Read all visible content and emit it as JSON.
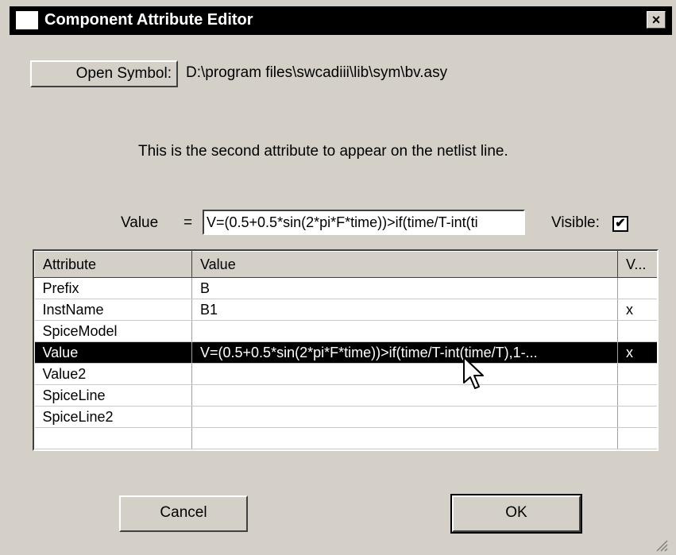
{
  "window": {
    "title": "Component Attribute Editor",
    "close_glyph": "×"
  },
  "symbol": {
    "open_button_label": "Open Symbol:",
    "path": "D:\\program files\\swcadiii\\lib\\sym\\bv.asy"
  },
  "description": "This is the second attribute to appear on the netlist line.",
  "value_field": {
    "label": "Value",
    "equals": "=",
    "text": "V=(0.5+0.5*sin(2*pi*F*time))>if(time/T-int(ti",
    "visible_label": "Visible:",
    "visible_checked": true,
    "check_glyph": "✔"
  },
  "table": {
    "headers": [
      "Attribute",
      "Value",
      "V..."
    ],
    "rows": [
      {
        "attr": "Prefix",
        "value": "B",
        "vis": ""
      },
      {
        "attr": "InstName",
        "value": "B1",
        "vis": "x"
      },
      {
        "attr": "SpiceModel",
        "value": "",
        "vis": ""
      },
      {
        "attr": "Value",
        "value": "V=(0.5+0.5*sin(2*pi*F*time))>if(time/T-int(time/T),1-...",
        "vis": "x",
        "selected": true
      },
      {
        "attr": "Value2",
        "value": "",
        "vis": ""
      },
      {
        "attr": "SpiceLine",
        "value": "",
        "vis": ""
      },
      {
        "attr": "SpiceLine2",
        "value": "",
        "vis": ""
      },
      {
        "attr": "",
        "value": "",
        "vis": ""
      }
    ]
  },
  "buttons": {
    "cancel": "Cancel",
    "ok": "OK"
  },
  "colors": {
    "face": "#d4d0c8",
    "titlebar": "#000000",
    "selection": "#000000"
  },
  "icons": [
    "window-icon",
    "close-icon",
    "mouse-cursor-icon",
    "resize-grip-icon"
  ]
}
